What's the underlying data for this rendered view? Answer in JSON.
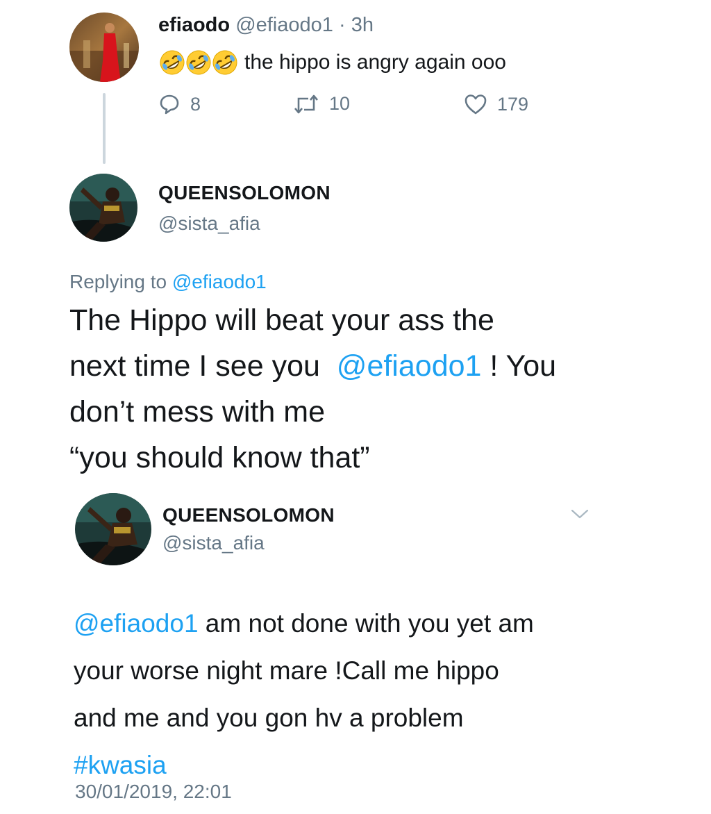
{
  "tweet1": {
    "display_name": "efiaodo",
    "handle": "@efiaodo1",
    "separator": "·",
    "time": "3h",
    "emojis": [
      "rolling-on-floor-laughing",
      "rolling-on-floor-laughing",
      "rolling-on-floor-laughing"
    ],
    "text": "the hippo is angry again ooo",
    "reply_count": "8",
    "retweet_count": "10",
    "like_count": "179"
  },
  "tweet2": {
    "display_name": "QUEENSOLOMON",
    "handle": "@sista_afia",
    "replying_prefix": "Replying to",
    "replying_handle": "@efiaodo1",
    "line1": "The Hippo will beat your ass  the",
    "line2_a": "next time I see you  ",
    "line2_mention": "@efiaodo1",
    "line2_b": " ! You",
    "line3": "don’t mess with me",
    "line4": "“you should know that”"
  },
  "tweet3": {
    "display_name": "QUEENSOLOMON",
    "handle": "@sista_afia",
    "mention": "@efiaodo1",
    "line1_rest": " am not done with you yet am",
    "line2": "your worse night mare !Call me hippo",
    "line3": "and me and you gon hv a problem",
    "hashtag": "#kwasia",
    "timestamp": "30/01/2019, 22:01"
  },
  "colors": {
    "link": "#1da1f2",
    "secondary_text": "#657786",
    "primary_text": "#14171a",
    "thread_line": "#ccd6dd"
  }
}
